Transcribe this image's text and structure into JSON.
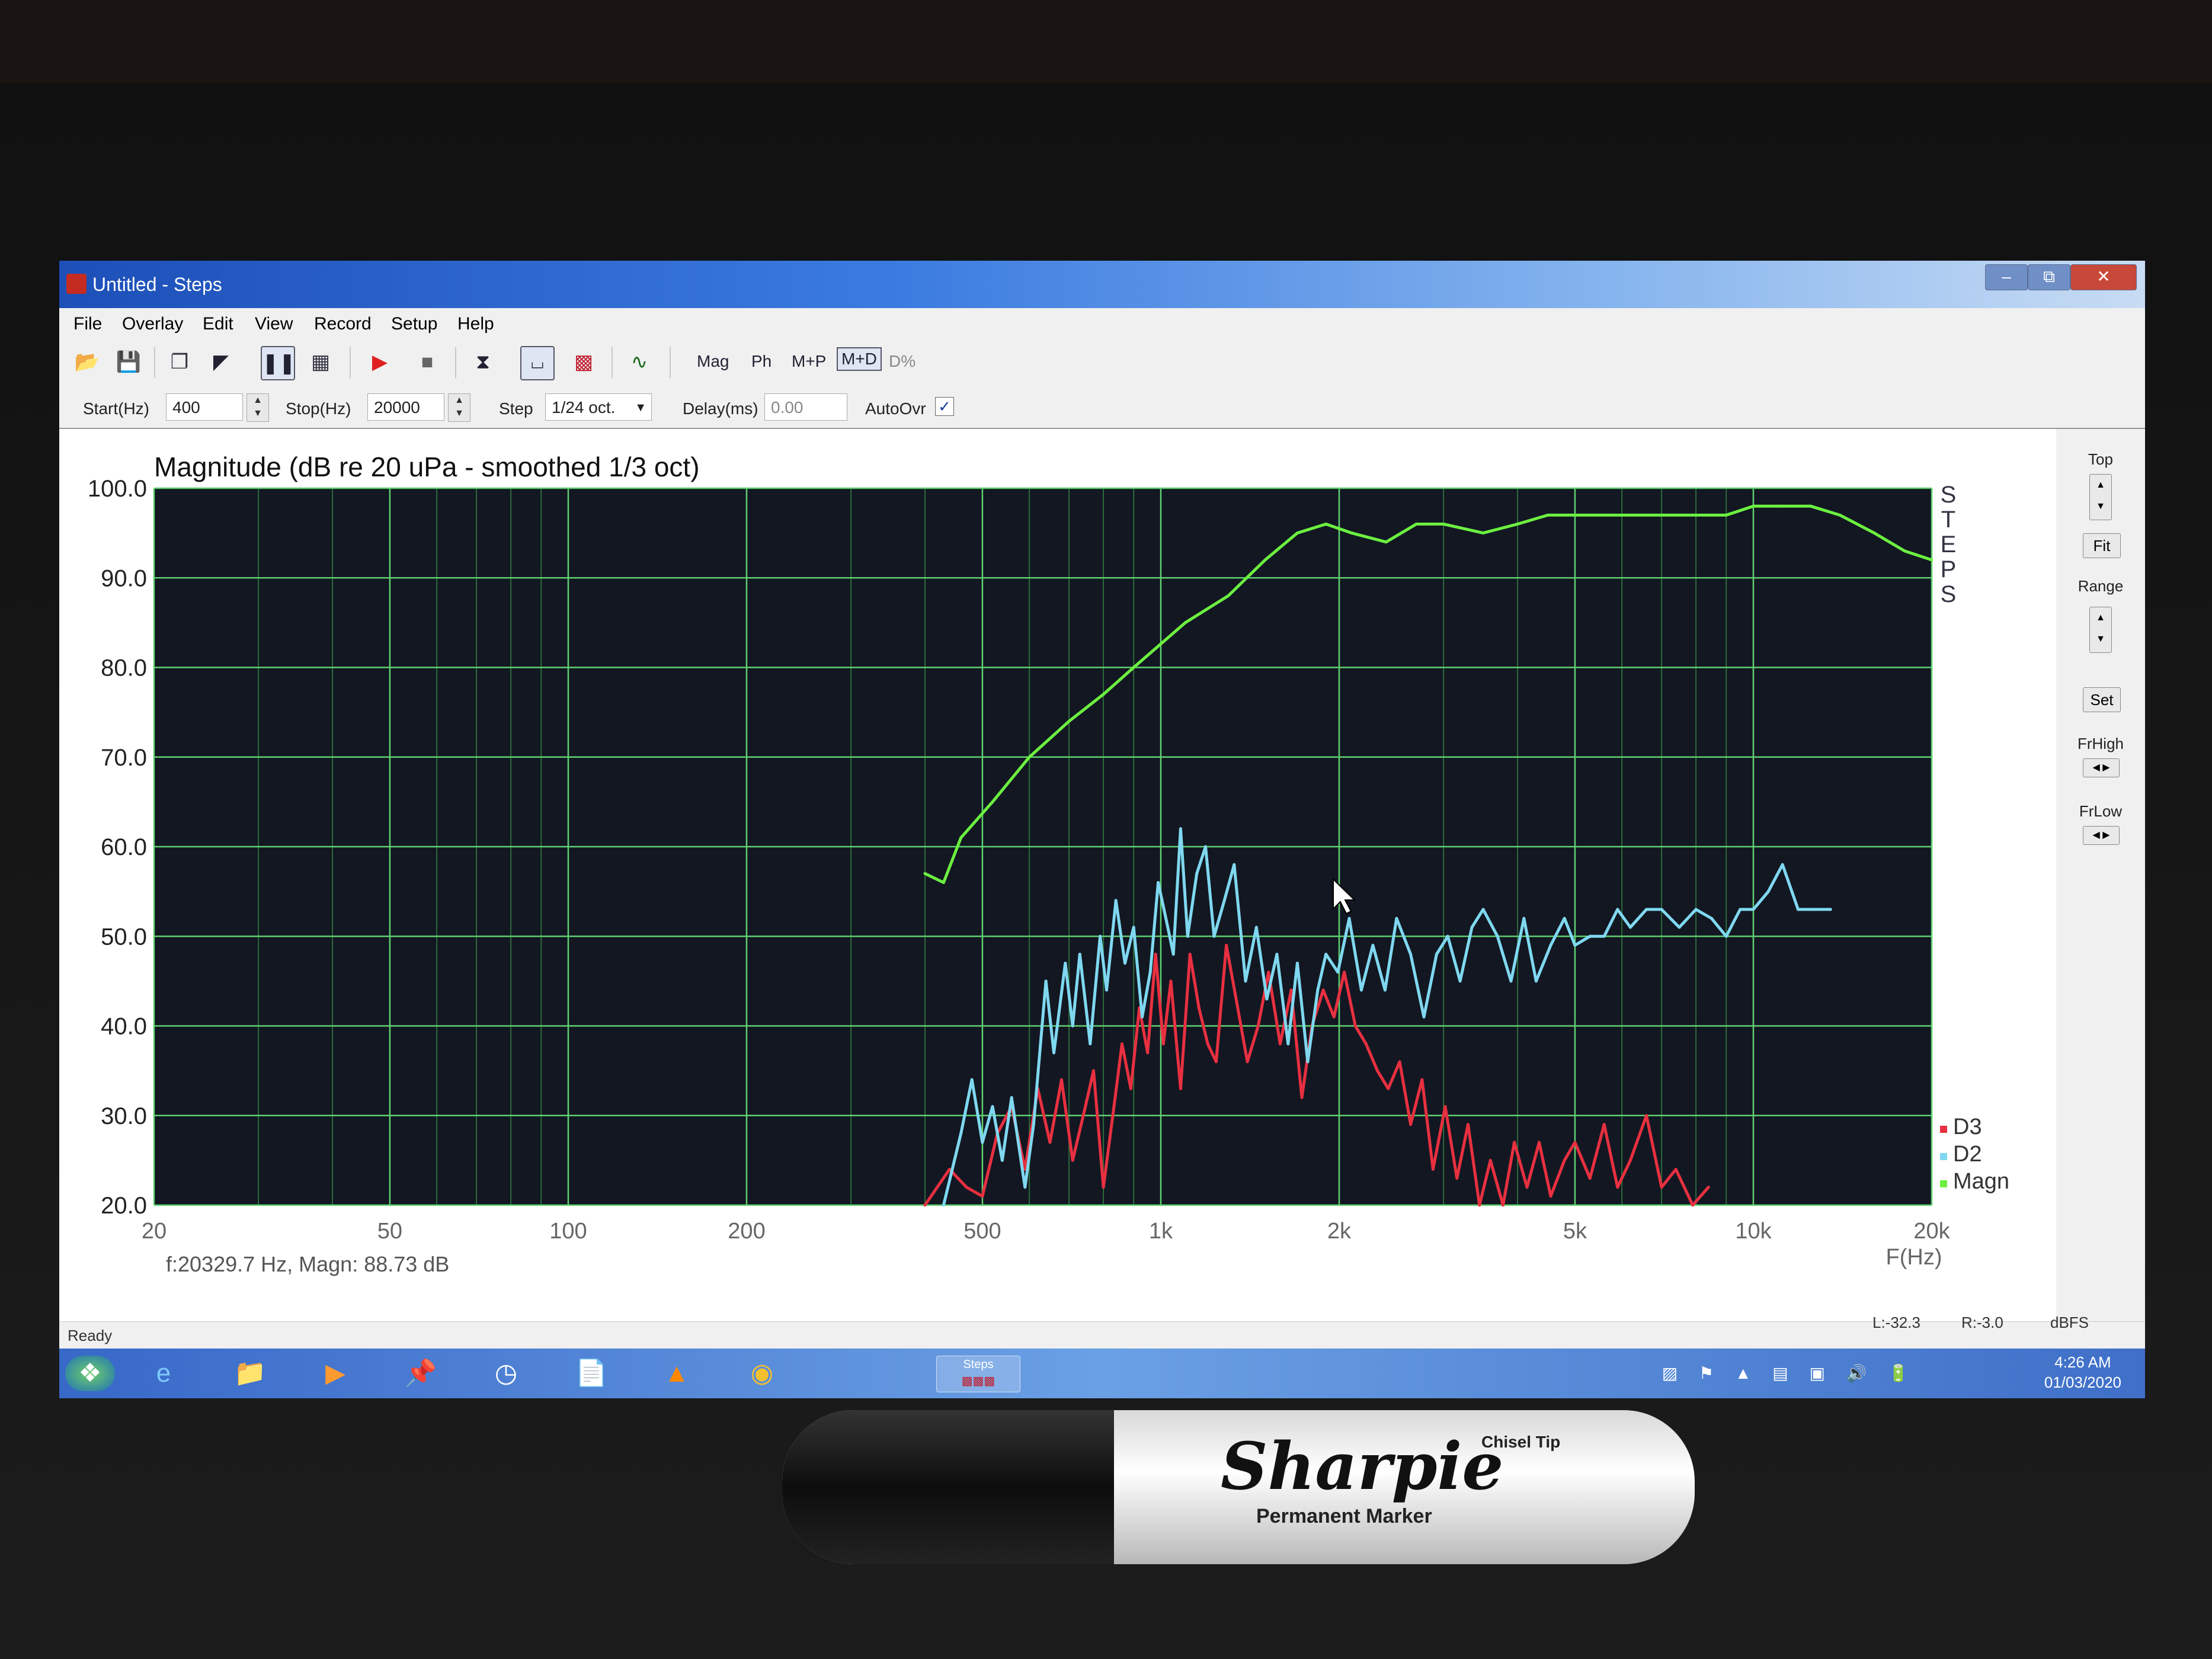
{
  "window": {
    "title": "Untitled - Steps",
    "controls": [
      "–",
      "⧉",
      "✕"
    ]
  },
  "menu": [
    "File",
    "Overlay",
    "Edit",
    "View",
    "Record",
    "Setup",
    "Help"
  ],
  "toolbar": {
    "view_modes": [
      "Mag",
      "Ph",
      "M+P",
      "M+D",
      "D%"
    ],
    "selected_view": "M+D"
  },
  "params": {
    "start_label": "Start(Hz)",
    "start_value": "400",
    "stop_label": "Stop(Hz)",
    "stop_value": "20000",
    "step_label": "Step",
    "step_value": "1/24 oct.",
    "delay_label": "Delay(ms)",
    "delay_value": "0.00",
    "autoovr_label": "AutoOvr",
    "autoovr_checked": true
  },
  "right_panel": {
    "top_label": "Top",
    "fit_label": "Fit",
    "range_label": "Range",
    "set_label": "Set",
    "frhigh_label": "FrHigh",
    "frlow_label": "FrLow"
  },
  "readout": "f:20329.7 Hz, Magn: 88.73 dB",
  "status": {
    "text": "Ready",
    "l": "L:-32.3",
    "r": "R:-3.0",
    "unit": "dBFS"
  },
  "clock": {
    "time": "4:26 AM",
    "date": "01/03/2020"
  },
  "taskbar_steps_label": "Steps",
  "marker": {
    "brand": "Sharpie",
    "sub": "Permanent Marker",
    "tip": "Chisel Tip"
  },
  "chart_data": {
    "type": "line",
    "title": "Magnitude (dB re 20 uPa - smoothed 1/3 oct)",
    "xlabel": "F(Hz)",
    "ylabel": "",
    "x_scale": "log",
    "xlim": [
      20,
      20000
    ],
    "ylim": [
      20,
      100
    ],
    "grid": true,
    "x_ticks": [
      20,
      50,
      100,
      200,
      500,
      1000,
      2000,
      5000,
      10000,
      20000
    ],
    "x_tick_labels": [
      "20",
      "50",
      "100",
      "200",
      "500",
      "1k",
      "2k",
      "5k",
      "10k",
      "20k"
    ],
    "y_ticks": [
      20,
      30,
      40,
      50,
      60,
      70,
      80,
      90,
      100
    ],
    "y_tick_labels": [
      "20.0",
      "30.0",
      "40.0",
      "50.0",
      "60.0",
      "70.0",
      "80.0",
      "90.0",
      "100.0"
    ],
    "side_label": [
      "S",
      "T",
      "E",
      "P",
      "S"
    ],
    "legend_position": "bottom-right",
    "series": [
      {
        "name": "Magn",
        "color": "#6cf040",
        "points": [
          [
            400,
            57
          ],
          [
            430,
            56
          ],
          [
            460,
            61
          ],
          [
            520,
            65
          ],
          [
            600,
            70
          ],
          [
            700,
            74
          ],
          [
            800,
            77
          ],
          [
            900,
            80
          ],
          [
            1100,
            85
          ],
          [
            1300,
            88
          ],
          [
            1500,
            92
          ],
          [
            1700,
            95
          ],
          [
            1900,
            96
          ],
          [
            2100,
            95
          ],
          [
            2400,
            94
          ],
          [
            2700,
            96
          ],
          [
            3000,
            96
          ],
          [
            3500,
            95
          ],
          [
            4000,
            96
          ],
          [
            4500,
            97
          ],
          [
            5000,
            97
          ],
          [
            6000,
            97
          ],
          [
            7000,
            97
          ],
          [
            8000,
            97
          ],
          [
            9000,
            97
          ],
          [
            10000,
            98
          ],
          [
            11000,
            98
          ],
          [
            12500,
            98
          ],
          [
            14000,
            97
          ],
          [
            16000,
            95
          ],
          [
            18000,
            93
          ],
          [
            20000,
            92
          ]
        ]
      },
      {
        "name": "D2",
        "color": "#7fd8f0",
        "points": [
          [
            430,
            20
          ],
          [
            460,
            28
          ],
          [
            480,
            34
          ],
          [
            500,
            27
          ],
          [
            520,
            31
          ],
          [
            540,
            25
          ],
          [
            560,
            32
          ],
          [
            590,
            22
          ],
          [
            610,
            29
          ],
          [
            640,
            45
          ],
          [
            660,
            37
          ],
          [
            690,
            47
          ],
          [
            710,
            40
          ],
          [
            730,
            48
          ],
          [
            760,
            38
          ],
          [
            790,
            50
          ],
          [
            810,
            44
          ],
          [
            840,
            54
          ],
          [
            870,
            47
          ],
          [
            900,
            51
          ],
          [
            930,
            41
          ],
          [
            960,
            46
          ],
          [
            990,
            56
          ],
          [
            1020,
            52
          ],
          [
            1050,
            48
          ],
          [
            1080,
            62
          ],
          [
            1110,
            50
          ],
          [
            1150,
            57
          ],
          [
            1190,
            60
          ],
          [
            1230,
            50
          ],
          [
            1280,
            54
          ],
          [
            1330,
            58
          ],
          [
            1390,
            45
          ],
          [
            1450,
            51
          ],
          [
            1510,
            43
          ],
          [
            1570,
            48
          ],
          [
            1640,
            38
          ],
          [
            1700,
            47
          ],
          [
            1770,
            36
          ],
          [
            1840,
            44
          ],
          [
            1900,
            48
          ],
          [
            1990,
            46
          ],
          [
            2080,
            52
          ],
          [
            2180,
            44
          ],
          [
            2280,
            49
          ],
          [
            2390,
            44
          ],
          [
            2500,
            52
          ],
          [
            2640,
            48
          ],
          [
            2780,
            41
          ],
          [
            2920,
            48
          ],
          [
            3050,
            50
          ],
          [
            3200,
            45
          ],
          [
            3350,
            51
          ],
          [
            3500,
            53
          ],
          [
            3700,
            50
          ],
          [
            3900,
            45
          ],
          [
            4100,
            52
          ],
          [
            4300,
            45
          ],
          [
            4550,
            49
          ],
          [
            4800,
            52
          ],
          [
            5000,
            49
          ],
          [
            5300,
            50
          ],
          [
            5600,
            50
          ],
          [
            5900,
            53
          ],
          [
            6200,
            51
          ],
          [
            6600,
            53
          ],
          [
            7000,
            53
          ],
          [
            7500,
            51
          ],
          [
            8000,
            53
          ],
          [
            8500,
            52
          ],
          [
            9000,
            50
          ],
          [
            9500,
            53
          ],
          [
            10000,
            53
          ],
          [
            10600,
            55
          ],
          [
            11200,
            58
          ],
          [
            11900,
            53
          ],
          [
            12600,
            53
          ],
          [
            13500,
            53
          ]
        ]
      },
      {
        "name": "D3",
        "color": "#e83040",
        "points": [
          [
            400,
            20
          ],
          [
            440,
            24
          ],
          [
            470,
            22
          ],
          [
            500,
            21
          ],
          [
            530,
            28
          ],
          [
            560,
            31
          ],
          [
            590,
            24
          ],
          [
            620,
            33
          ],
          [
            650,
            27
          ],
          [
            680,
            34
          ],
          [
            710,
            25
          ],
          [
            740,
            30
          ],
          [
            770,
            35
          ],
          [
            800,
            22
          ],
          [
            830,
            30
          ],
          [
            860,
            38
          ],
          [
            890,
            33
          ],
          [
            920,
            42
          ],
          [
            950,
            37
          ],
          [
            980,
            48
          ],
          [
            1010,
            38
          ],
          [
            1040,
            45
          ],
          [
            1080,
            33
          ],
          [
            1120,
            48
          ],
          [
            1160,
            42
          ],
          [
            1200,
            38
          ],
          [
            1240,
            36
          ],
          [
            1290,
            49
          ],
          [
            1340,
            43
          ],
          [
            1400,
            36
          ],
          [
            1460,
            40
          ],
          [
            1520,
            46
          ],
          [
            1590,
            38
          ],
          [
            1660,
            44
          ],
          [
            1730,
            32
          ],
          [
            1800,
            40
          ],
          [
            1880,
            44
          ],
          [
            1960,
            41
          ],
          [
            2040,
            46
          ],
          [
            2130,
            40
          ],
          [
            2220,
            38
          ],
          [
            2320,
            35
          ],
          [
            2420,
            33
          ],
          [
            2530,
            36
          ],
          [
            2640,
            29
          ],
          [
            2760,
            34
          ],
          [
            2880,
            24
          ],
          [
            3020,
            31
          ],
          [
            3160,
            23
          ],
          [
            3300,
            29
          ],
          [
            3450,
            20
          ],
          [
            3600,
            25
          ],
          [
            3780,
            20
          ],
          [
            3950,
            27
          ],
          [
            4150,
            22
          ],
          [
            4350,
            27
          ],
          [
            4550,
            21
          ],
          [
            4800,
            25
          ],
          [
            5000,
            27
          ],
          [
            5300,
            23
          ],
          [
            5600,
            29
          ],
          [
            5900,
            22
          ],
          [
            6200,
            25
          ],
          [
            6600,
            30
          ],
          [
            7000,
            22
          ],
          [
            7400,
            24
          ],
          [
            7900,
            20
          ],
          [
            8400,
            22
          ]
        ]
      }
    ]
  }
}
